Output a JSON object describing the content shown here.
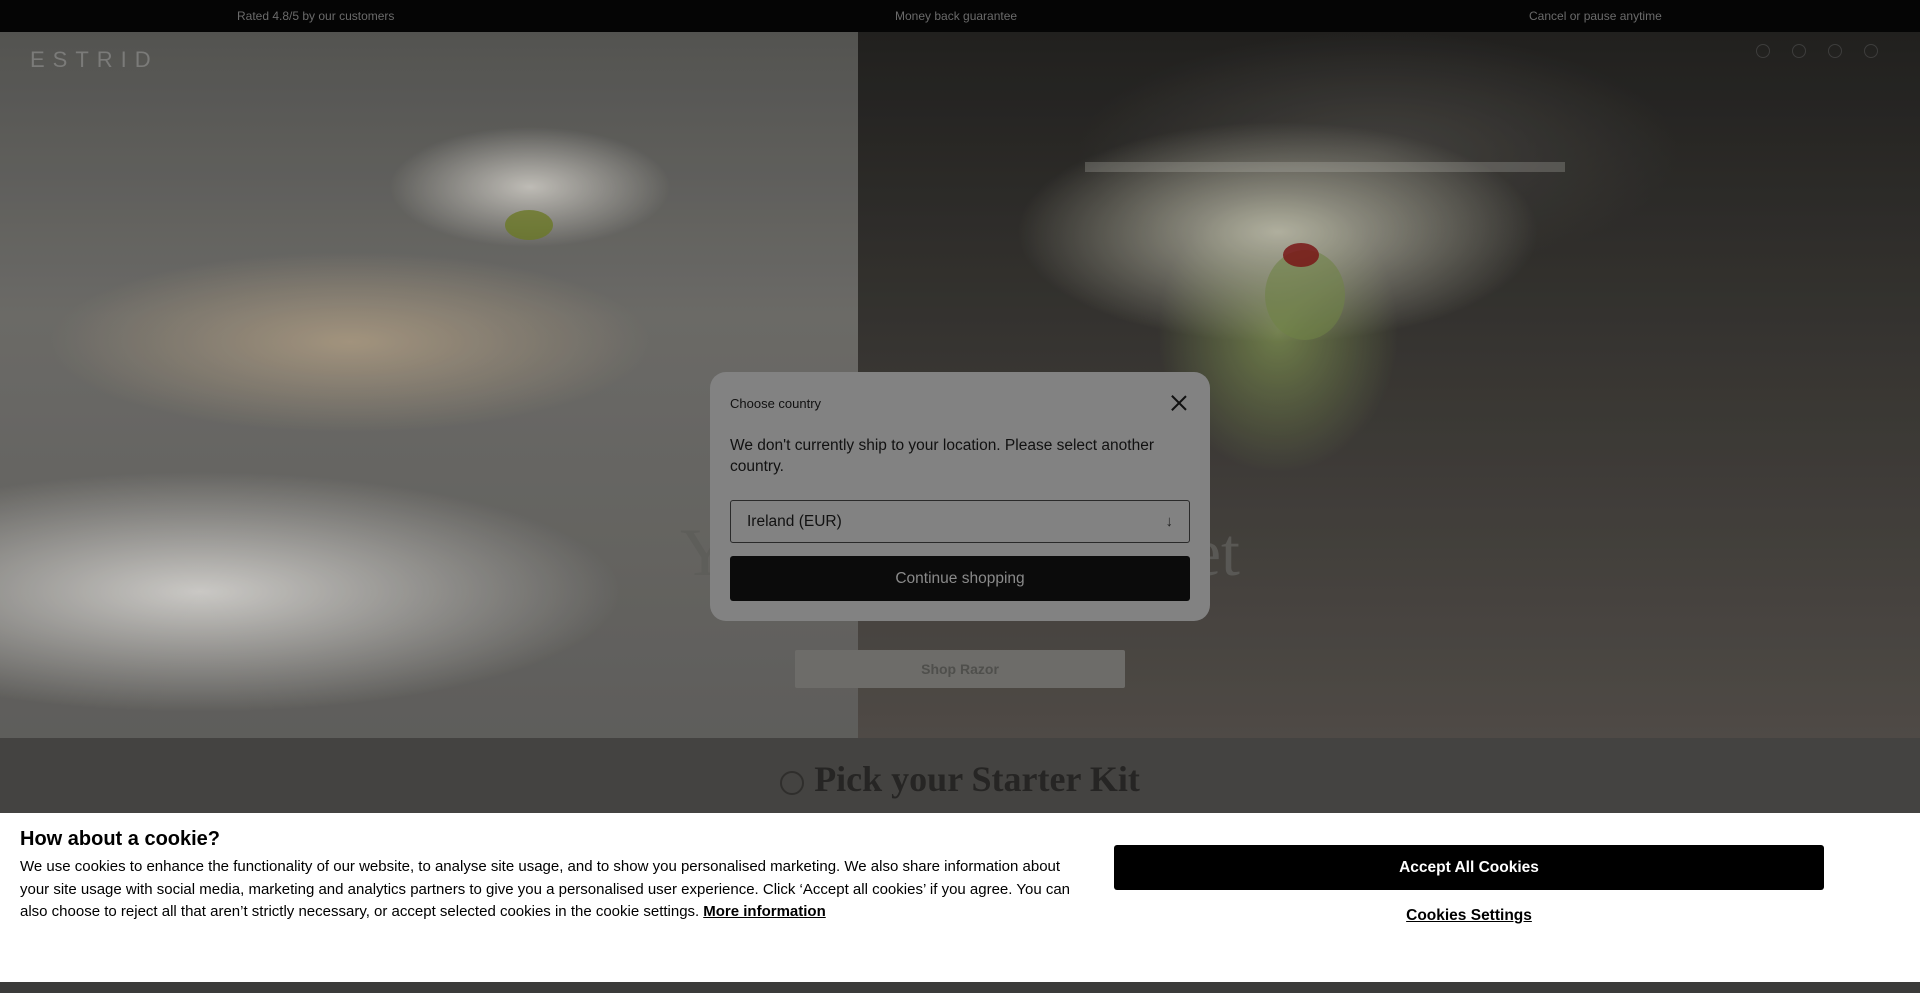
{
  "announcement": {
    "items": [
      "Rated 4.8/5 by our customers",
      "Money back guarantee",
      "Cancel or pause anytime"
    ]
  },
  "header": {
    "logo": "ESTRID",
    "icons": [
      "search-icon",
      "account-icon",
      "cart-icon",
      "menu-icon"
    ]
  },
  "hero": {
    "title": "Your Best Shave Yet",
    "cta_label": "Shop Razor"
  },
  "section": {
    "title": "Pick your Starter Kit",
    "icon": "clock-icon"
  },
  "modal": {
    "title": "Choose country",
    "message": "We don't currently ship to your location. Please select another country.",
    "selected_country": "Ireland (EUR)",
    "select_icon": "arrow-down-icon",
    "continue_label": "Continue shopping",
    "close_icon": "close-icon"
  },
  "cookie_banner": {
    "title": "How about a cookie?",
    "text": "We use cookies to enhance the functionality of our website, to analyse site usage, and to show you personalised marketing. We also share information about your site usage with social media, marketing and analytics partners to give you a personalised user experience. Click ‘Accept all cookies’ if you agree. You can also choose to reject all that aren’t strictly necessary, or accept selected cookies in the cookie settings.",
    "more_info_label": "More information",
    "accept_label": "Accept All Cookies",
    "settings_label": "Cookies Settings"
  }
}
